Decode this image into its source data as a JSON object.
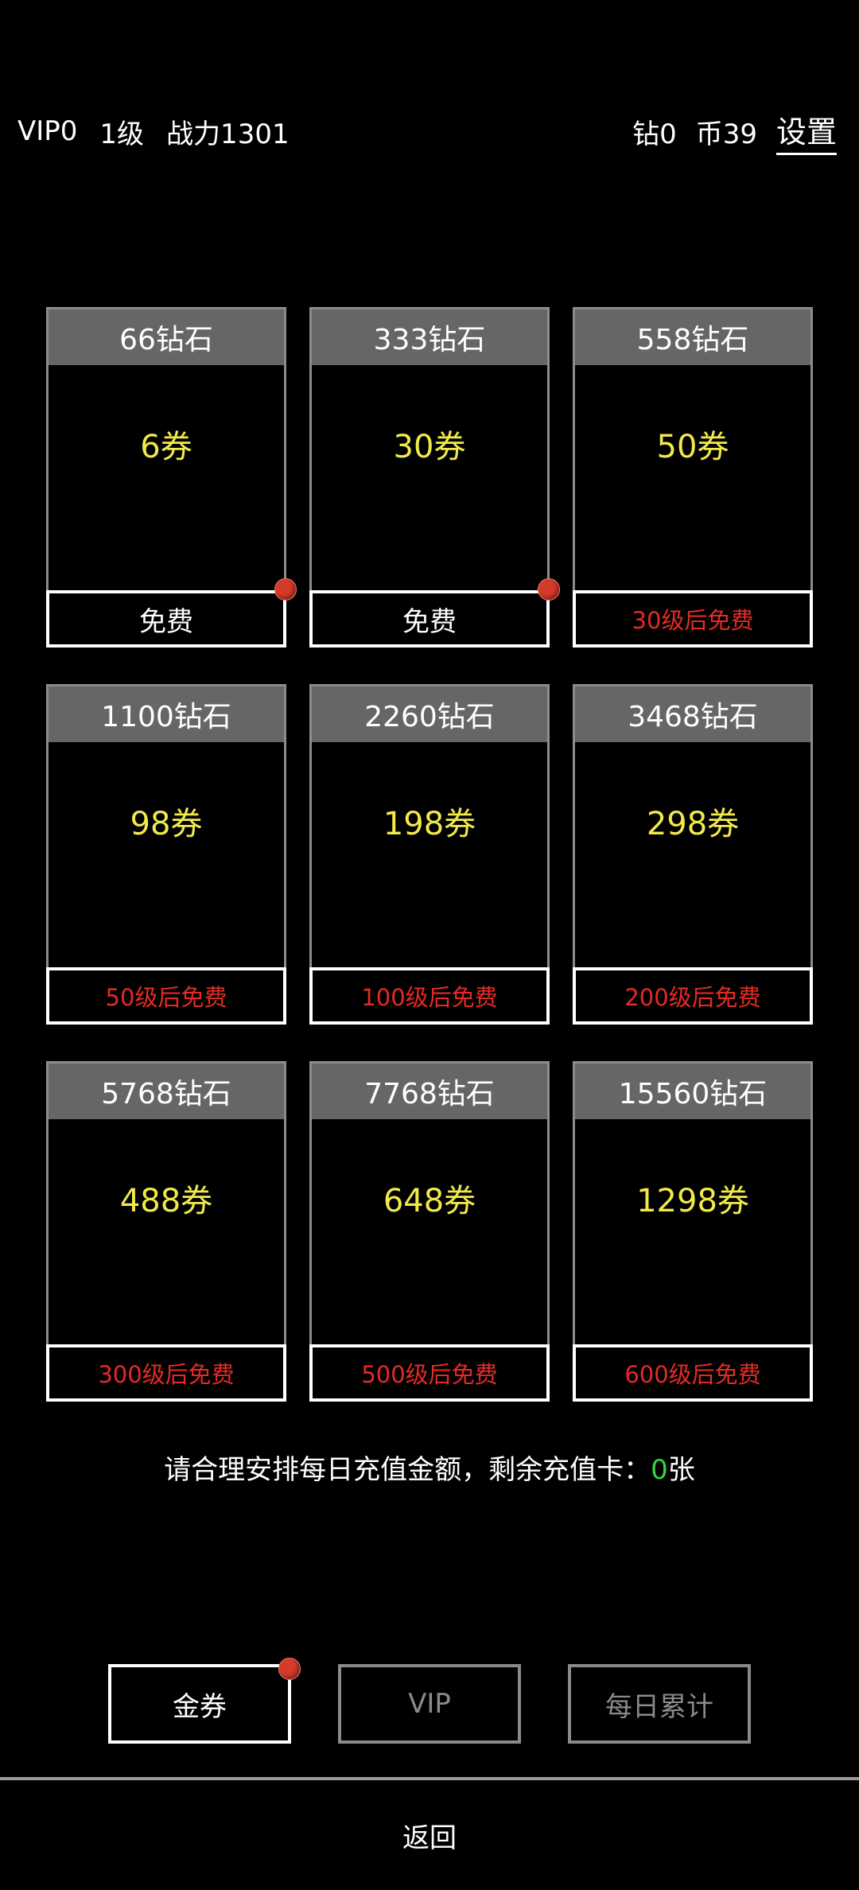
{
  "status": {
    "vip": "VIP0",
    "level": "1级",
    "power": "战力1301",
    "diamonds": "钻0",
    "coins": "币39",
    "settings": "设置"
  },
  "cards": [
    {
      "title": "66钻石",
      "reward": "6券",
      "button": "免费",
      "locked": false,
      "badge": true
    },
    {
      "title": "333钻石",
      "reward": "30券",
      "button": "免费",
      "locked": false,
      "badge": true
    },
    {
      "title": "558钻石",
      "reward": "50券",
      "button": "30级后免费",
      "locked": true,
      "badge": false
    },
    {
      "title": "1100钻石",
      "reward": "98券",
      "button": "50级后免费",
      "locked": true,
      "badge": false
    },
    {
      "title": "2260钻石",
      "reward": "198券",
      "button": "100级后免费",
      "locked": true,
      "badge": false
    },
    {
      "title": "3468钻石",
      "reward": "298券",
      "button": "200级后免费",
      "locked": true,
      "badge": false
    },
    {
      "title": "5768钻石",
      "reward": "488券",
      "button": "300级后免费",
      "locked": true,
      "badge": false
    },
    {
      "title": "7768钻石",
      "reward": "648券",
      "button": "500级后免费",
      "locked": true,
      "badge": false
    },
    {
      "title": "15560钻石",
      "reward": "1298券",
      "button": "600级后免费",
      "locked": true,
      "badge": false
    }
  ],
  "notice": {
    "prefix": "请合理安排每日充值金额，剩余充值卡：",
    "count": "0",
    "suffix": "张"
  },
  "tabs": {
    "gold": "金券",
    "vip": "VIP",
    "daily": "每日累计"
  },
  "footer": {
    "back": "返回"
  },
  "colors": {
    "reward": "#f2ea4a",
    "locked": "#e52a24",
    "count": "#33d642",
    "badge": "#d63a2a",
    "header_bg": "#666666"
  }
}
